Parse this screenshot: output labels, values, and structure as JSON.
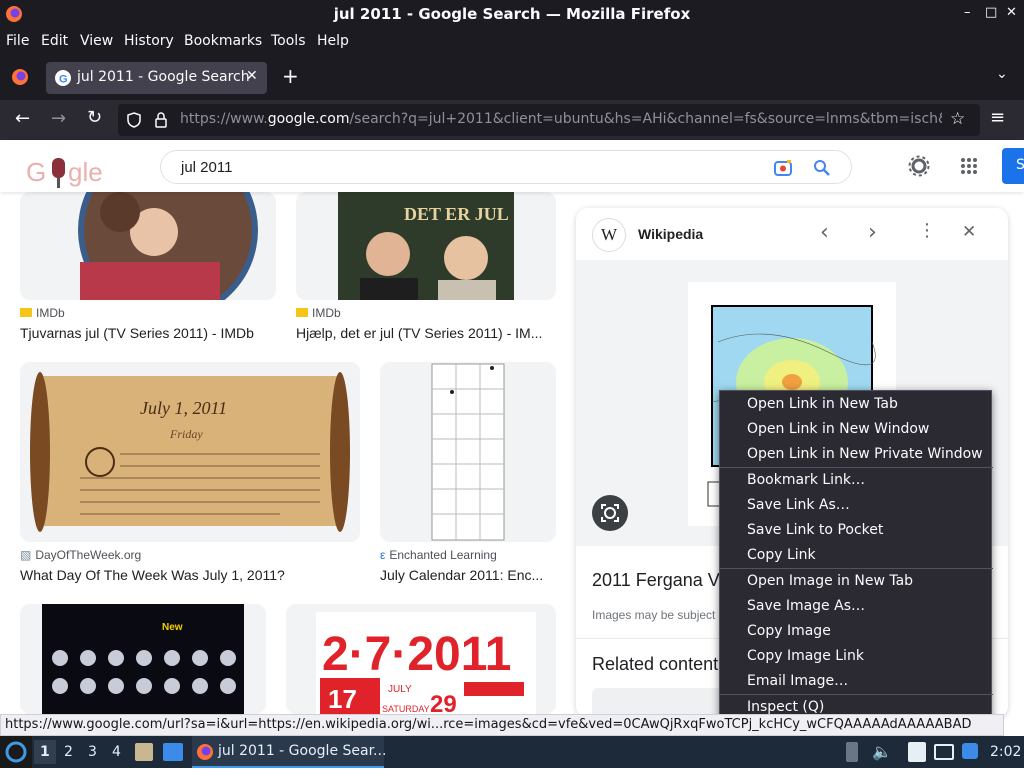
{
  "window": {
    "title": "jul 2011 - Google Search — Mozilla Firefox"
  },
  "menubar": [
    "File",
    "Edit",
    "View",
    "History",
    "Bookmarks",
    "Tools",
    "Help"
  ],
  "tab": {
    "title": "jul 2011 - Google Search"
  },
  "url": {
    "host_prefix": "https://www.",
    "domain": "google.com",
    "path": "/search?q=jul+2011&client=ubuntu&hs=AHi&channel=fs&source=lnms&tbm=isch&"
  },
  "search": {
    "query": "jul 2011",
    "button_label": "S"
  },
  "results": [
    {
      "source": "IMDb",
      "title": "Tjuvarnas jul (TV Series 2011) - IMDb"
    },
    {
      "source": "IMDb",
      "title": "Hjælp, det er jul (TV Series 2011) - IM..."
    },
    {
      "source": "DayOfTheWeek.org",
      "title": "What Day Of The Week Was July 1, 2011?"
    },
    {
      "source": "Enchanted Learning",
      "title": "July Calendar 2011: Enc..."
    }
  ],
  "image_text": {
    "poster2": "DET ER JUL",
    "scroll_heading": "July 1, 2011",
    "scroll_sub": "Friday",
    "cal_new": "New",
    "big_date": "2·7·2011",
    "big_month": "JULY",
    "big_day": "29",
    "big_weekday": "SATURDAY",
    "big_17": "17"
  },
  "panel": {
    "source": "Wikipedia",
    "title": "2011 Fergana Va",
    "notice": "Images may be subject",
    "related": "Related content"
  },
  "context_menu": [
    "Open Link in New Tab",
    "Open Link in New Window",
    "Open Link in New Private Window",
    "Bookmark Link…",
    "Save Link As…",
    "Save Link to Pocket",
    "Copy Link",
    "Open Image in New Tab",
    "Save Image As…",
    "Copy Image",
    "Copy Image Link",
    "Email Image…",
    "Inspect (Q)"
  ],
  "status_url": "https://www.google.com/url?sa=i&url=https://en.wikipedia.org/wi...rce=images&cd=vfe&ved=0CAwQjRxqFwoTCPj_kcHCy_wCFQAAAAAdAAAAABAD",
  "taskbar": {
    "workspaces": [
      "1",
      "2",
      "3",
      "4"
    ],
    "task_label": "jul 2011 - Google Sear...",
    "clock": "2:02"
  },
  "colors": {
    "chrome_dark": "#1c1b22",
    "nav": "#2b2a33",
    "google_blue": "#1a73e8",
    "taskbar": "#1d2a3a"
  }
}
